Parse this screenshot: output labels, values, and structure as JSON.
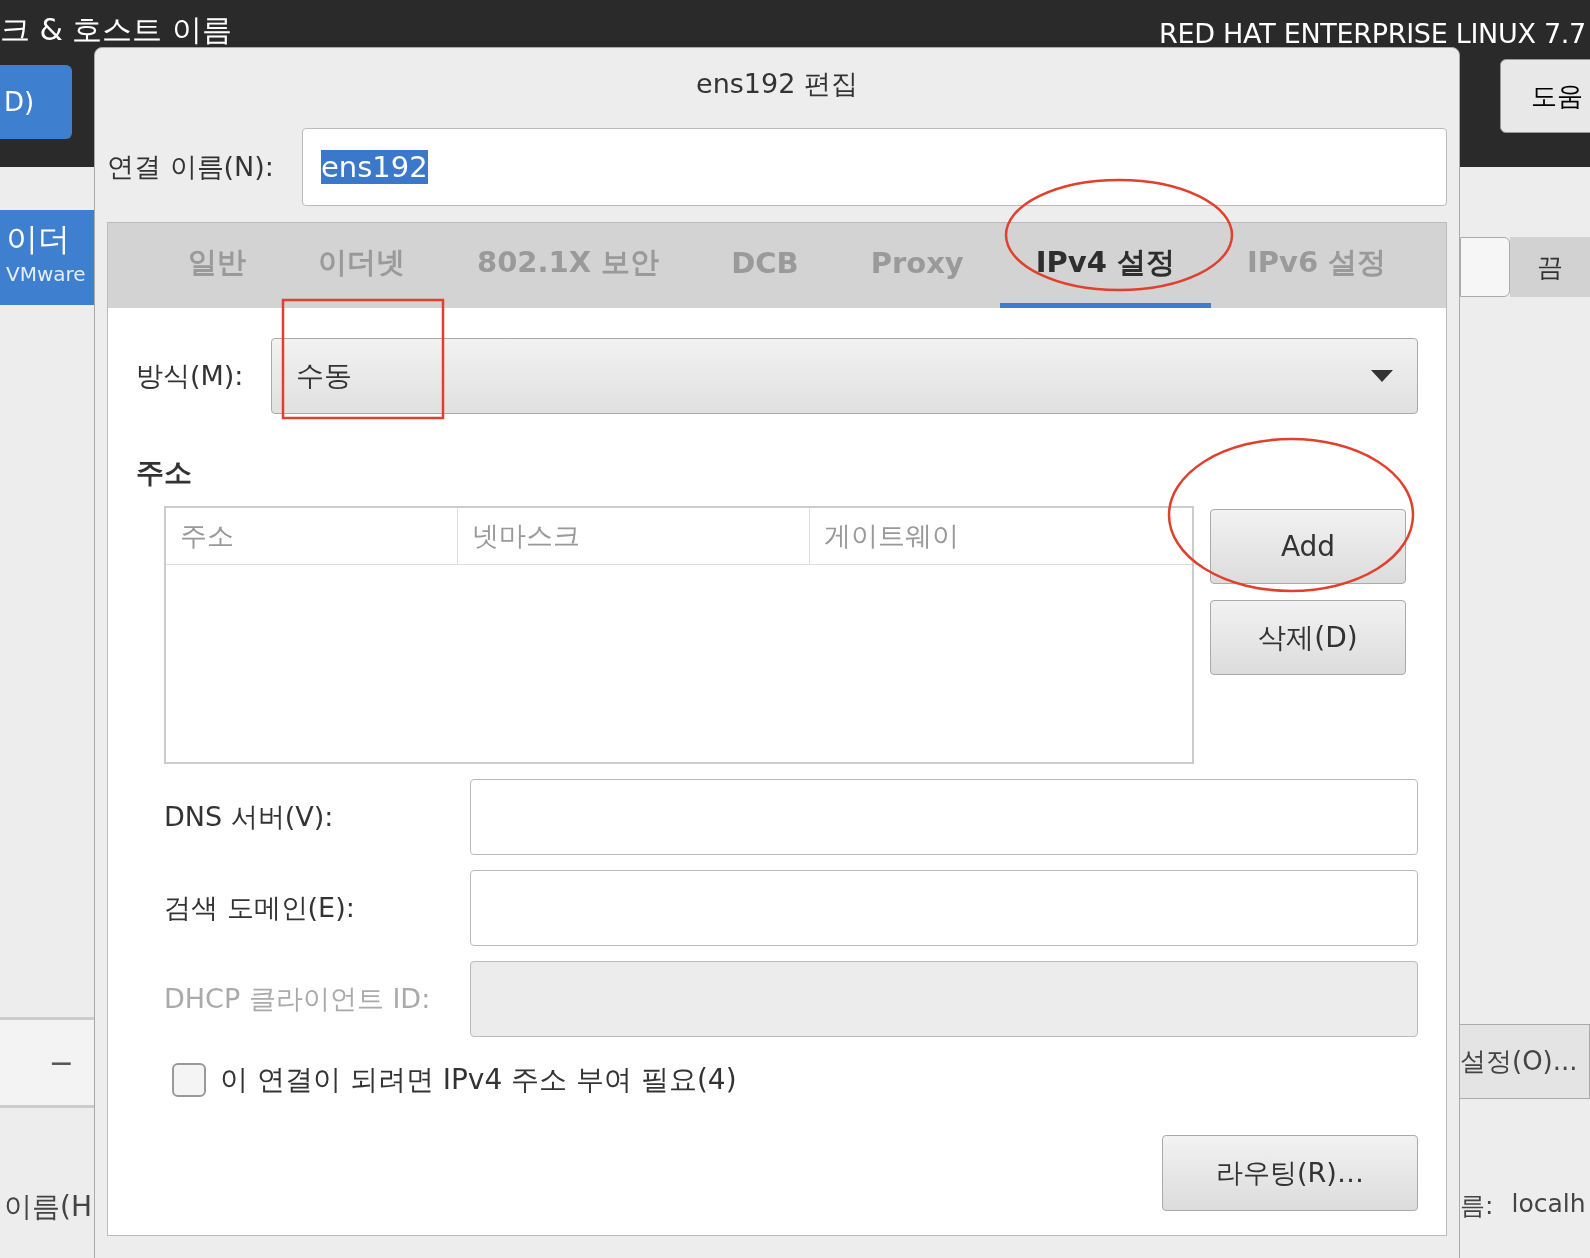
{
  "background": {
    "title": "크 & 호스트 이름",
    "left_button": "D)",
    "product": "RED HAT ENTERPRISE LINUX 7.7",
    "help_button": "도움",
    "device": {
      "name": "이더",
      "sub": "VMware"
    },
    "switch": {
      "label": "끔",
      "on": false
    },
    "remove_button": "−",
    "hostname_label": "이름(H",
    "settings_button": "설정(O)...",
    "hostname_label_right": "름:",
    "hostname_value": "localh"
  },
  "dialog": {
    "title": "ens192 편집",
    "connection_name": {
      "label": "연결 이름(N):",
      "value": "ens192"
    },
    "tabs": [
      {
        "label": "일반",
        "selected": false
      },
      {
        "label": "이더넷",
        "selected": false
      },
      {
        "label": "802.1X 보안",
        "selected": false
      },
      {
        "label": "DCB",
        "selected": false
      },
      {
        "label": "Proxy",
        "selected": false
      },
      {
        "label": "IPv4 설정",
        "selected": true
      },
      {
        "label": "IPv6 설정",
        "selected": false
      }
    ],
    "method": {
      "label": "방식(M):",
      "value": "수동"
    },
    "addresses": {
      "heading": "주소",
      "columns": [
        "주소",
        "넷마스크",
        "게이트웨이"
      ],
      "buttons": [
        "Add",
        "삭제(D)"
      ]
    },
    "fields": [
      {
        "label": "DNS 서버(V):",
        "disabled": false
      },
      {
        "label": "검색 도메인(E):",
        "disabled": false
      },
      {
        "label": "DHCP 클라이언트 ID:",
        "disabled": true
      }
    ],
    "require": {
      "label": "이 연결이 되려면 IPv4 주소 부여 필요(4)",
      "checked": false
    },
    "routes_button": "라우팅(R)…"
  }
}
